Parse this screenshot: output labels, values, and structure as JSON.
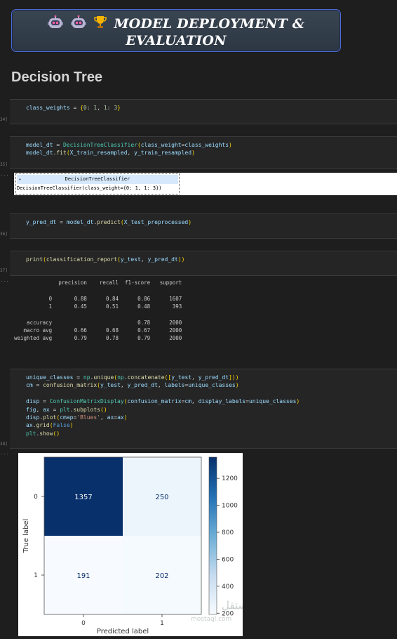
{
  "banner": {
    "line1": "MODEL DEPLOYMENT &",
    "line2": "EVALUATION",
    "icons": [
      "robot-emoji",
      "robot-emoji",
      "trophy-emoji"
    ]
  },
  "section_title": "Decision Tree",
  "cells": [
    {
      "number": "34]",
      "code": [
        "class_weights = {0: 1, 1: 3}"
      ]
    },
    {
      "number": "35]",
      "code": [
        "model_dt = DecisionTreeClassifier(class_weight=class_weights)",
        "model_dt.fit(X_train_resampled, y_train_resampled)"
      ]
    },
    {
      "number": "36]",
      "code": [
        "y_pred_dt = model_dt.predict(X_test_preprocessed)"
      ]
    },
    {
      "number": "37]",
      "code": [
        "print(classification_report(y_test, y_pred_dt))"
      ]
    },
    {
      "number": "38]",
      "code": [
        "unique_classes = np.unique(np.concatenate([y_test, y_pred_dt]))",
        "cm = confusion_matrix(y_test, y_pred_dt, labels=unique_classes)",
        "",
        "disp = ConfusionMatrixDisplay(confusion_matrix=cm, display_labels=unique_classes)",
        "fig, ax = plt.subplots()",
        "disp.plot(cmap='Blues', ax=ax)",
        "ax.grid(False)",
        "plt.show()"
      ]
    }
  ],
  "output_dots": "...",
  "estimator": {
    "header": "DecisionTreeClassifier",
    "toggle": "▸",
    "body": "DecisionTreeClassifier(class_weight={0: 1, 1: 3})"
  },
  "report": {
    "header": "              precision    recall  f1-score   support",
    "rows": [
      "           0       0.88      0.84      0.86      1607",
      "           1       0.45      0.51      0.48       393",
      "",
      "    accuracy                           0.78      2000",
      "   macro avg       0.66      0.68      0.67      2000",
      "weighted avg       0.79      0.78      0.79      2000"
    ]
  },
  "chart_data": {
    "type": "heatmap",
    "title": "",
    "xlabel": "Predicted label",
    "ylabel": "True label",
    "x_categories": [
      "0",
      "1"
    ],
    "y_categories": [
      "0",
      "1"
    ],
    "matrix": [
      [
        1357,
        250
      ],
      [
        191,
        202
      ]
    ],
    "colormap": "Blues",
    "colorbar_ticks": [
      200,
      400,
      600,
      800,
      1000,
      1200
    ],
    "colorbar_range": [
      191,
      1357
    ],
    "cell_text_colors": {
      "dark": "#ffffff",
      "light": "#08306b"
    }
  },
  "watermark": {
    "line1": "مستقل",
    "line2": "mostaql.com"
  }
}
